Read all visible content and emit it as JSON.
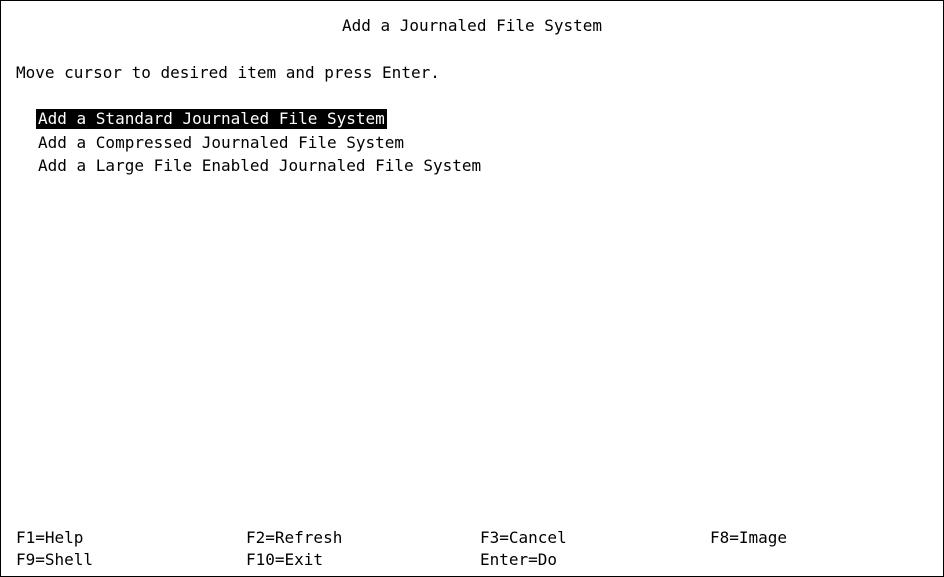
{
  "header": {
    "title": "Add a Journaled File System"
  },
  "instruction": "Move cursor to desired item and press Enter.",
  "menu": {
    "items": [
      {
        "label": "Add a Standard Journaled File System",
        "selected": true
      },
      {
        "label": "Add a Compressed Journaled File System",
        "selected": false
      },
      {
        "label": "Add a Large File Enabled Journaled File System",
        "selected": false
      }
    ]
  },
  "function_keys": {
    "f1": "F1=Help",
    "f2": "F2=Refresh",
    "f3": "F3=Cancel",
    "f8": "F8=Image",
    "f9": "F9=Shell",
    "f10": "F10=Exit",
    "enter": "Enter=Do"
  }
}
